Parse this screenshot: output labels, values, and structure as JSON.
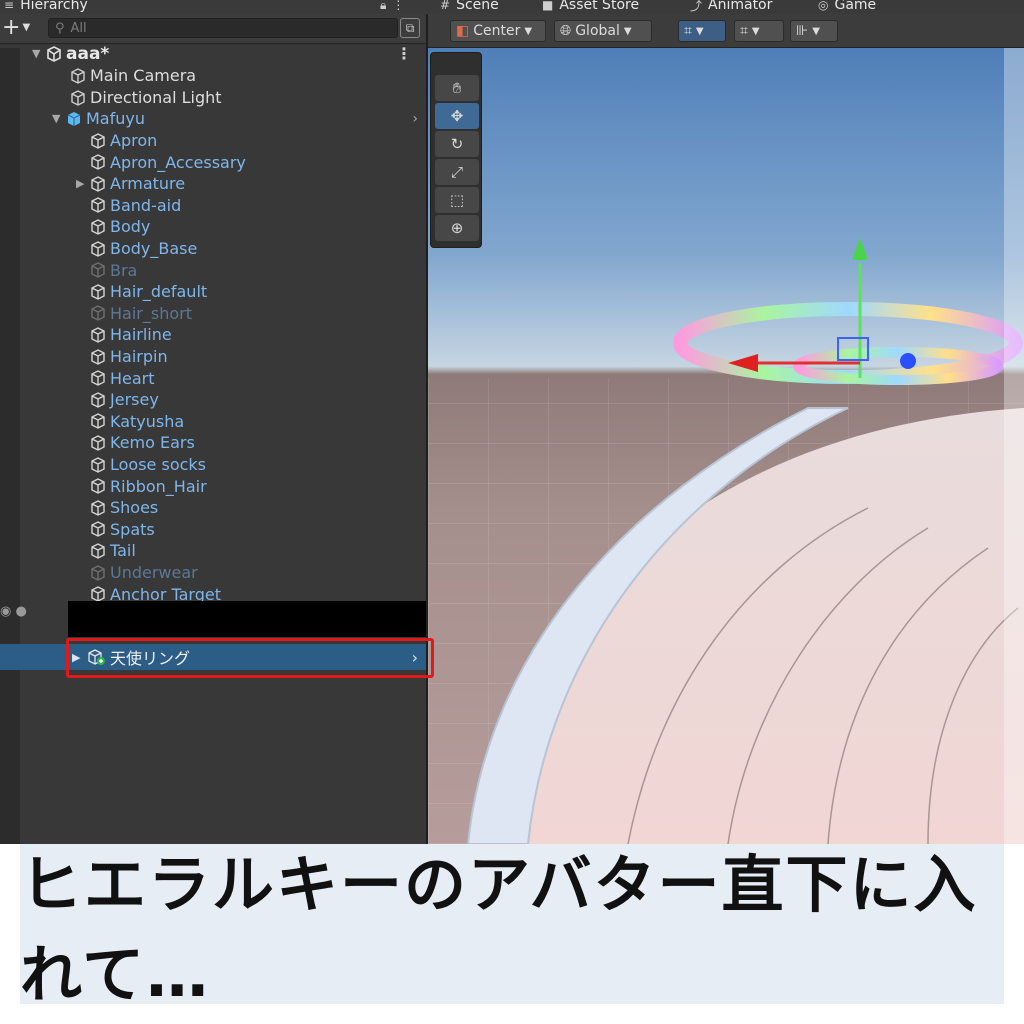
{
  "tabs": {
    "hierarchy": "Hierarchy",
    "scene": "Scene",
    "asset_store": "Asset Store",
    "animator": "Animator",
    "game": "Game"
  },
  "hierarchy": {
    "add_button": "+",
    "search_placeholder": "All",
    "scene_name": "aaa*",
    "root_items": [
      "Main Camera",
      "Directional Light"
    ],
    "avatar_name": "Mafuyu",
    "children": [
      {
        "label": "Apron",
        "state": "active"
      },
      {
        "label": "Apron_Accessary",
        "state": "active"
      },
      {
        "label": "Armature",
        "state": "active",
        "expandable": true
      },
      {
        "label": "Band-aid",
        "state": "active"
      },
      {
        "label": "Body",
        "state": "active"
      },
      {
        "label": "Body_Base",
        "state": "active"
      },
      {
        "label": "Bra",
        "state": "inactive"
      },
      {
        "label": "Hair_default",
        "state": "active"
      },
      {
        "label": "Hair_short",
        "state": "inactive"
      },
      {
        "label": "Hairline",
        "state": "active"
      },
      {
        "label": "Hairpin",
        "state": "active"
      },
      {
        "label": "Heart",
        "state": "active"
      },
      {
        "label": "Jersey",
        "state": "active"
      },
      {
        "label": "Katyusha",
        "state": "active"
      },
      {
        "label": "Kemo Ears",
        "state": "active"
      },
      {
        "label": "Loose socks",
        "state": "active"
      },
      {
        "label": "Ribbon_Hair",
        "state": "active"
      },
      {
        "label": "Shoes",
        "state": "active"
      },
      {
        "label": "Spats",
        "state": "active"
      },
      {
        "label": "Tail",
        "state": "active"
      },
      {
        "label": "Underwear",
        "state": "inactive"
      },
      {
        "label": "Anchor Target",
        "state": "active"
      }
    ],
    "selected_item": "天使リング"
  },
  "scene_toolbar": {
    "pivot": "Center",
    "space": "Global"
  },
  "caption": "ヒエラルキーのアバター直下に入れて…",
  "colors": {
    "selection": "#2c5d87",
    "highlight_box": "#e01a1a",
    "prefab_text": "#7fb6ec"
  }
}
